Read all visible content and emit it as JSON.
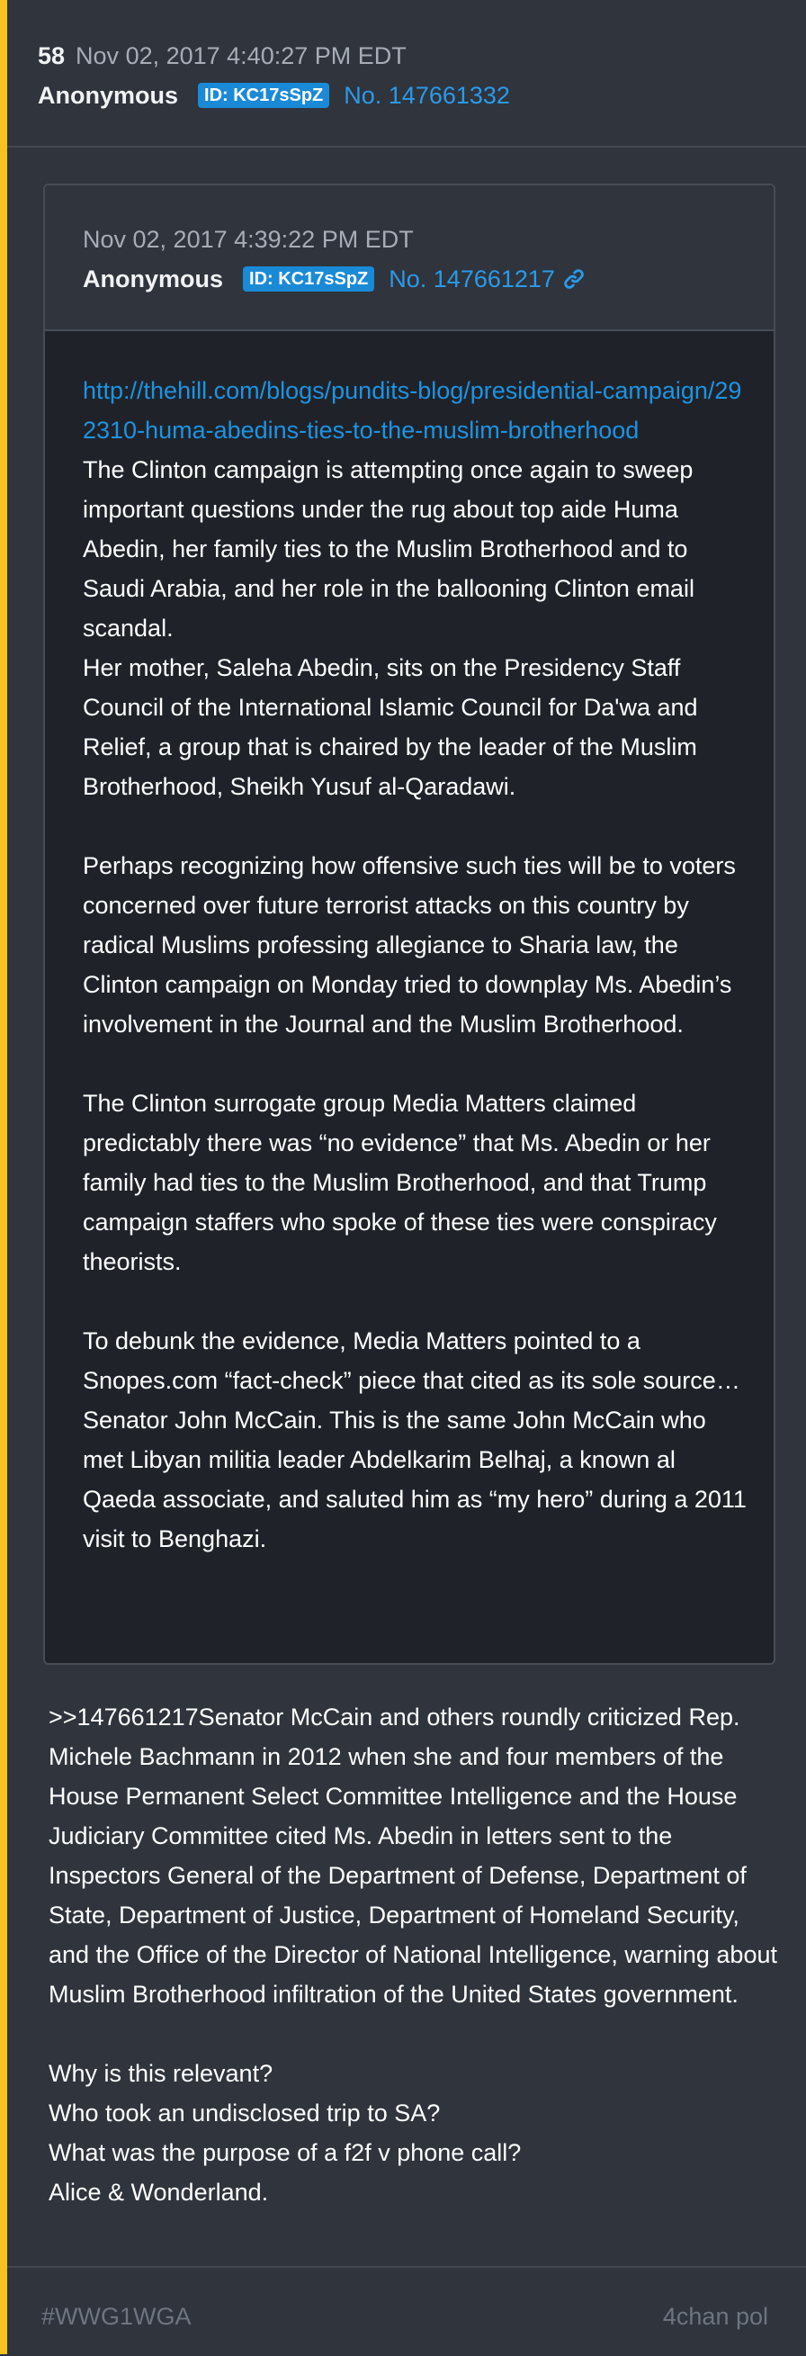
{
  "post": {
    "number": "58",
    "timestamp": "Nov 02, 2017 4:40:27 PM EDT",
    "author": "Anonymous",
    "id_label": "ID: KC17sSpZ",
    "post_no": "No. 147661332",
    "accent_color": "#f6c21b"
  },
  "quote": {
    "timestamp": "Nov 02, 2017 4:39:22 PM EDT",
    "author": "Anonymous",
    "id_label": "ID: KC17sSpZ",
    "post_no": "No. 147661217",
    "link_icon": "chain-link-icon",
    "url": "http://thehill.com/blogs/pundits-blog/presidential-campaign/292310-huma-abedins-ties-to-the-muslim-brotherhood",
    "paragraphs": [
      "The Clinton campaign is attempting once again to sweep important questions under the rug about top aide Huma Abedin, her family ties to the Muslim Brotherhood and to Saudi Arabia, and her role in the ballooning Clinton email scandal.",
      "Her mother, Saleha Abedin, sits on the Presidency Staff Council of the International Islamic Council for Da'wa and Relief, a group that is chaired by the leader of the Muslim Brotherhood, Sheikh Yusuf al-Qaradawi.",
      "Perhaps recognizing how offensive such ties will be to voters concerned over future terrorist attacks on this country by radical Muslims professing allegiance to Sharia law, the Clinton campaign on Monday tried to downplay Ms. Abedin’s involvement in the Journal and the Muslim Brotherhood.",
      "The Clinton surrogate group Media Matters claimed predictably there was “no evidence” that Ms. Abedin or her family had ties to the Muslim Brotherhood, and that Trump campaign staffers who spoke of these ties were conspiracy theorists.",
      "To debunk the evidence, Media Matters pointed to a Snopes.com “fact-check” piece that cited as its sole source… Senator John McCain. This is the same John McCain who met Libyan militia leader Abdelkarim Belhaj, a known al Qaeda associate, and saluted him as “my hero” during a 2011 visit to Benghazi."
    ]
  },
  "body": {
    "main_paragraph": ">>147661217Senator McCain and others roundly criticized Rep. Michele Bachmann in 2012 when she and four members of the House Permanent Select Committee Intelligence and the House Judiciary Committee cited Ms. Abedin in letters sent to the Inspectors General of the Department of Defense, Department of State, Department of Justice, Department of Homeland Security, and the Office of the Director of National Intelligence, warning about Muslim Brotherhood infiltration of the United States government.",
    "lines": [
      "Why is this relevant?",
      "Who took an undisclosed trip to SA?",
      "What was the purpose of a f2f v phone call?",
      "Alice & Wonderland."
    ]
  },
  "footer": {
    "hashtag": "#WWG1WGA",
    "source": "4chan pol"
  }
}
